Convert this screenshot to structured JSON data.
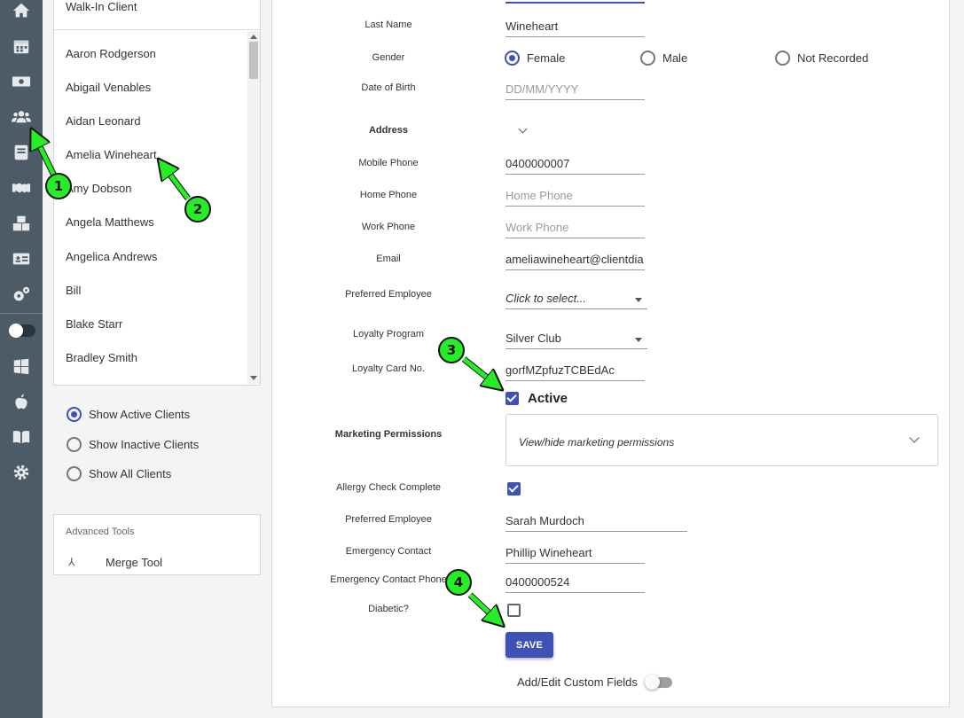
{
  "rail": {
    "icons": [
      "home-icon",
      "calendar-icon",
      "cash-icon",
      "clients-icon",
      "book-icon",
      "handshake-icon",
      "boxes-icon",
      "id-card-icon",
      "settings-icon",
      "toggle-switch",
      "windows-icon",
      "apple-icon",
      "manual-icon",
      "gear-icon"
    ]
  },
  "clients": {
    "walk_in": "Walk-In Client",
    "items": [
      "Aaron Rodgerson",
      "Abigail Venables",
      "Aidan Leonard",
      "Amelia Wineheart",
      "Amy Dobson",
      "Angela Matthews",
      "Angelica Andrews",
      "Bill",
      "Blake Starr",
      "Bradley Smith"
    ],
    "filters": [
      {
        "label": "Show Active Clients",
        "selected": true
      },
      {
        "label": "Show Inactive Clients",
        "selected": false
      },
      {
        "label": "Show All Clients",
        "selected": false
      }
    ]
  },
  "advanced": {
    "title": "Advanced Tools",
    "merge_label": "Merge Tool"
  },
  "form": {
    "last_name_label": "Last Name",
    "last_name": "Wineheart",
    "gender_label": "Gender",
    "gender_options": [
      {
        "label": "Female",
        "selected": true
      },
      {
        "label": "Male",
        "selected": false
      },
      {
        "label": "Not Recorded",
        "selected": false
      }
    ],
    "dob_label": "Date of Birth",
    "dob_placeholder": "DD/MM/YYYY",
    "address_label": "Address",
    "mobile_label": "Mobile Phone",
    "mobile": "0400000007",
    "home_label": "Home Phone",
    "home_placeholder": "Home Phone",
    "work_label": "Work Phone",
    "work_placeholder": "Work Phone",
    "email_label": "Email",
    "email": "ameliawineheart@clientdia",
    "pref_emp_label": "Preferred Employee",
    "pref_emp_select": "Click to select...",
    "loyalty_label": "Loyalty Program",
    "loyalty_value": "Silver Club",
    "card_label": "Loyalty Card No.",
    "card_value": "gorfMZpfuzTCBEdAc",
    "active_label": "Active",
    "active_checked": true,
    "marketing_label": "Marketing Permissions",
    "marketing_toggle": "View/hide marketing permissions",
    "allergy_label": "Allergy Check Complete",
    "allergy_checked": true,
    "pref_emp2_label": "Preferred Employee",
    "pref_emp2_value": "Sarah Murdoch",
    "emergency_label": "Emergency Contact",
    "emergency_value": "Phillip Wineheart",
    "emergency_phone_label": "Emergency Contact Phone",
    "emergency_phone_value": "0400000524",
    "diabetic_label": "Diabetic?",
    "diabetic_checked": false,
    "save_label": "SAVE",
    "custom_fields_label": "Add/Edit Custom Fields",
    "custom_fields_on": false
  },
  "annotations": {
    "steps": [
      "1",
      "2",
      "3",
      "4"
    ],
    "color": "#26ee26"
  }
}
